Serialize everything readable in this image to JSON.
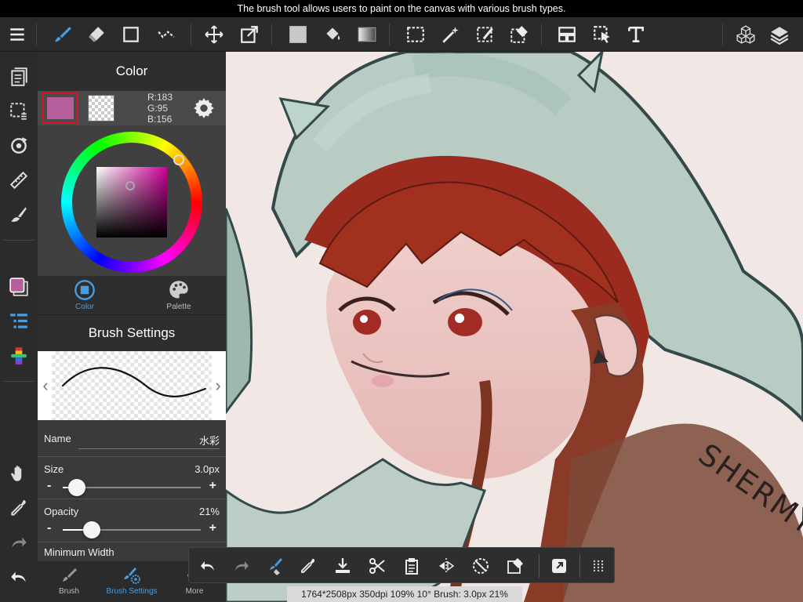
{
  "tooltip": "The brush tool allows users to paint on the canvas with various brush types.",
  "toolbar": {
    "tools": [
      "menu-icon",
      "brush-icon",
      "eraser-icon",
      "shape-icon",
      "select-pen-icon",
      "move-icon",
      "transform-icon",
      "fill-color-icon",
      "bucket-icon",
      "gradient-icon",
      "select-rect-icon",
      "magic-wand-icon",
      "select-lasso-icon",
      "select-erase-icon",
      "frame-icon",
      "operation-icon",
      "text-icon",
      "3d-icon",
      "layers-icon"
    ]
  },
  "color_panel": {
    "title": "Color",
    "main_color": "#b75f9c",
    "rgb": {
      "r": "R:183",
      "g": "G:95",
      "b": "B:156"
    },
    "tabs": {
      "color": "Color",
      "palette": "Palette"
    }
  },
  "brush_panel": {
    "title": "Brush Settings",
    "name_label": "Name",
    "name_value": "水彩",
    "size_label": "Size",
    "size_value": "3.0px",
    "size_fraction": 0.1,
    "opacity_label": "Opacity",
    "opacity_value": "21%",
    "opacity_fraction": 0.21,
    "min_width_label": "Minimum Width",
    "minus": "-",
    "plus": "+"
  },
  "panel_tabs": {
    "brush": "Brush",
    "brush_settings": "Brush Settings",
    "more": "More"
  },
  "canvas": {
    "signature": "SHERMYPOT"
  },
  "status": "1764*2508px 350dpi 109% 10° Brush: 3.0px 21%",
  "colors": {
    "accent": "#4a9ee0",
    "toolbar_bg": "#2b2b2b",
    "canvas_bg": "#f1e7e4"
  }
}
